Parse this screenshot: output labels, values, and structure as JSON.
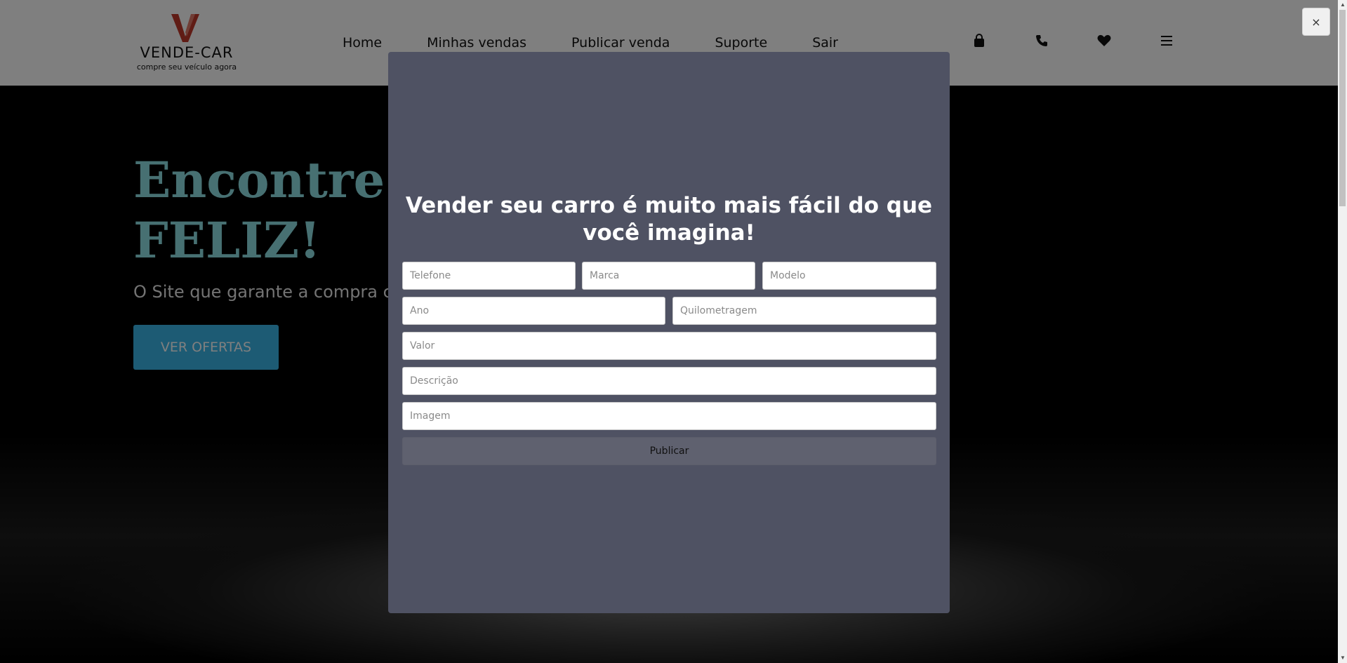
{
  "header": {
    "brand_name": "VENDE-CAR",
    "brand_tagline": "compre seu veículo agora",
    "nav": [
      "Home",
      "Minhas vendas",
      "Publicar venda",
      "Suporte",
      "Sair"
    ],
    "icons": [
      "bag-icon",
      "phone-icon",
      "heart-icon",
      "menu-icon"
    ]
  },
  "hero": {
    "title": "Encontre se\nFELIZ!",
    "subtitle": "O Site que garante a compra c",
    "cta_label": "VER OFERTAS"
  },
  "modal": {
    "close_label": "×",
    "title": "Vender seu carro é muito mais fácil do que você imagina!",
    "fields": {
      "telefone": "Telefone",
      "marca": "Marca",
      "modelo": "Modelo",
      "ano": "Ano",
      "quilometragem": "Quilometragem",
      "valor": "Valor",
      "descricao": "Descrição",
      "imagem": "Imagem"
    },
    "submit_label": "Publicar"
  },
  "colors": {
    "modal_bg": "#4f5263",
    "hero_title": "#8ee0e4",
    "cta_bg": "#3ab7e9",
    "logo_red": "#c0392b"
  }
}
